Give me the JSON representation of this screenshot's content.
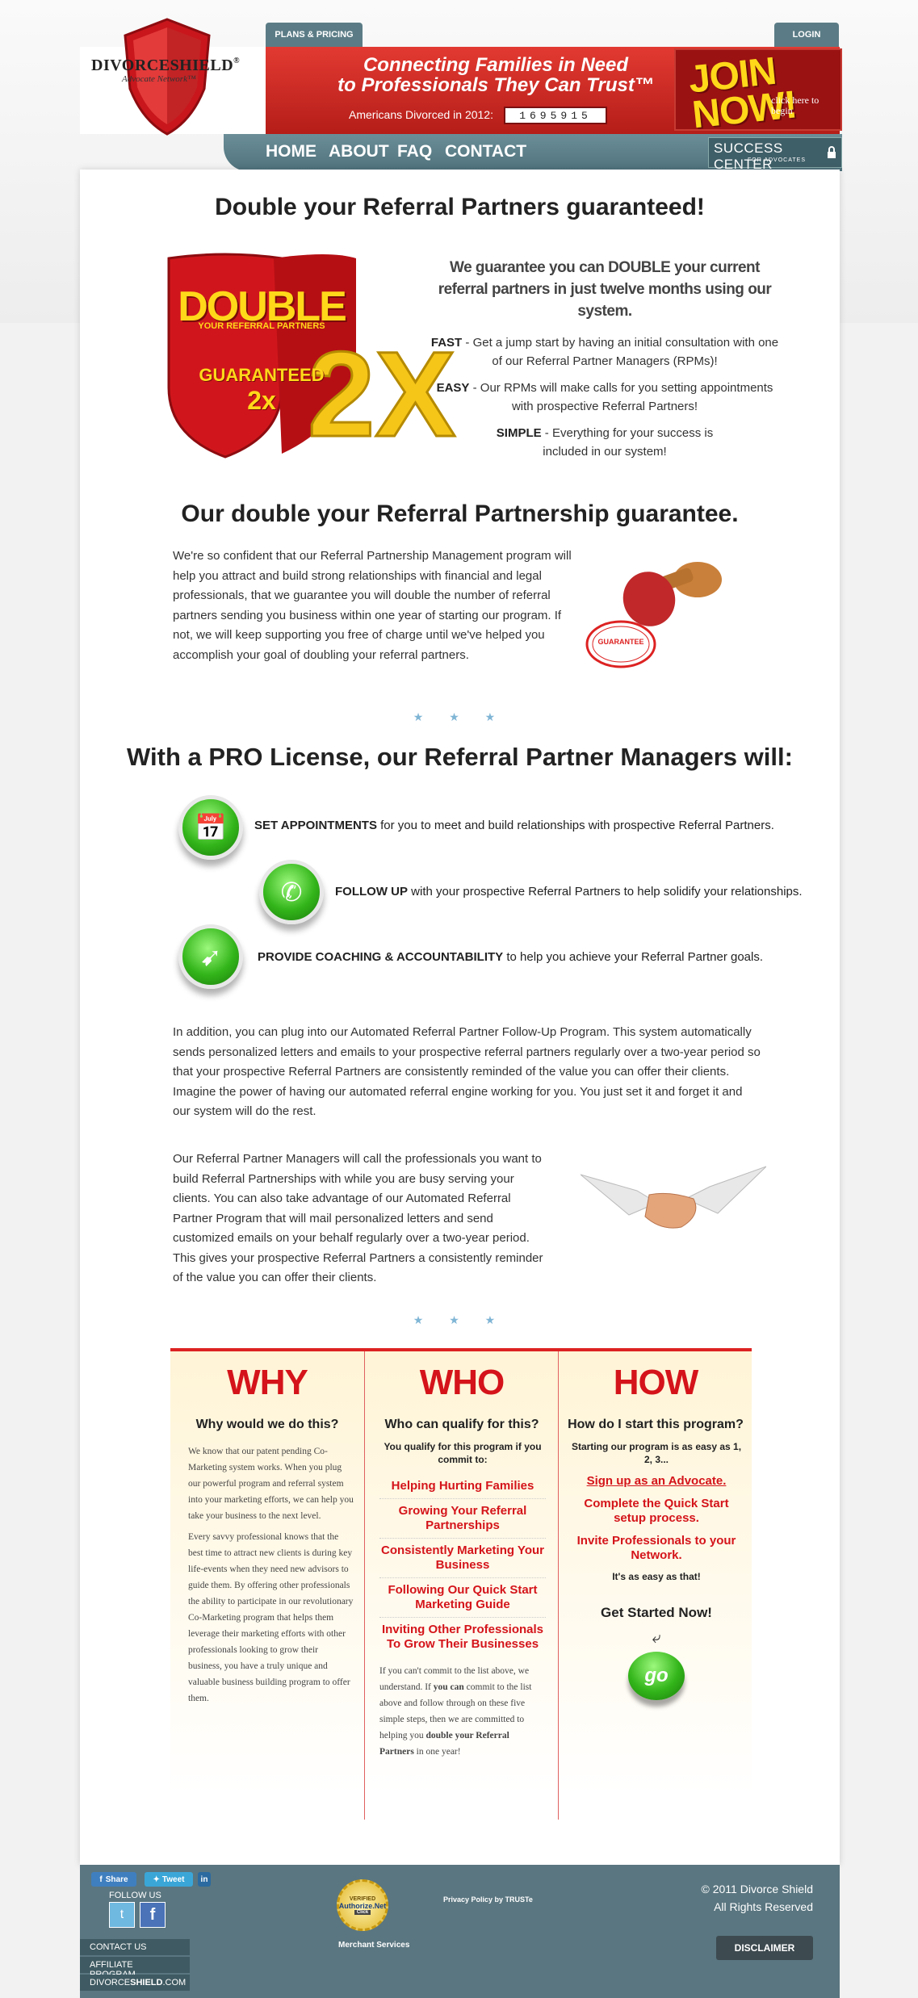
{
  "header": {
    "tab_plans": "PLANS & PRICING",
    "tab_login": "LOGIN",
    "logo_name_a": "DIVORCE",
    "logo_name_b": "SHIELD",
    "logo_reg": "®",
    "logo_sub": "Advocate Network™",
    "tagline_1": "Connecting Families in Need",
    "tagline_2": "to Professionals They Can Trust™",
    "counter_label": "Americans Divorced in 2012:",
    "counter_value": "1695915",
    "join_text": "JOIN NOW!",
    "join_small": "click here to begin",
    "nav": [
      "HOME",
      "ABOUT",
      "FAQ",
      "CONTACT"
    ],
    "success_title": "SUCCESS CENTER",
    "success_sub": "FOR ADVOCATES"
  },
  "hero": {
    "title": "Double your Referral Partners guaranteed!",
    "badge_double": "DOUBLE",
    "badge_sub": "YOUR REFERRAL PARTNERS",
    "badge_guar": "GUARANTEED",
    "badge_2x": "2x",
    "badge_big2x": "2X",
    "lead": "We guarantee you can DOUBLE your current referral partners in just twelve months using our system.",
    "fast_label": "FAST",
    "fast_text": "Get a jump start by having an initial consultation with one of our Referral Partner Managers (RPMs)!",
    "easy_label": "EASY",
    "easy_text": "Our RPMs will make calls for you setting appointments with prospective Referral Partners!",
    "simple_label": "SIMPLE",
    "simple_text": "Everything for your success is included in our system!"
  },
  "guarantee": {
    "title": "Our double your Referral Partnership guarantee.",
    "body": "We're so confident that our Referral Partnership Management program will help you attract and build strong relationships with financial and legal professionals, that we guarantee you will double the number of referral partners sending you business within one year of starting our program. If not, we will keep supporting you free of charge until we've helped you accomplish your goal of doubling your referral partners.",
    "stamp_text": "GUARANTEE"
  },
  "pro": {
    "title": "With a PRO License, our Referral Partner Managers will:",
    "f1_bold": "SET APPOINTMENTS",
    "f1_text": " for you to meet and build relationships with prospective Referral Partners.",
    "f2_bold": "FOLLOW UP",
    "f2_text": " with your prospective Referral Partners to help solidify your relationships.",
    "f3_bold": "PROVIDE COACHING & ACCOUNTABILITY",
    "f3_text": " to help you achieve your Referral Partner goals.",
    "para1": "In addition, you can plug into our Automated Referral Partner Follow-Up Program. This system automatically sends personalized letters and emails to your prospective referral partners regularly over a two-year period so that your prospective Referral Partners are consistently reminded of the value you can offer their clients. Imagine the power of having our automated referral engine working for you. You just set it and forget it and our system will do the rest.",
    "para2": "Our Referral Partner Managers will call the professionals you want to build Referral Partnerships with while you are busy serving your clients. You can also take advantage of our Automated Referral Partner Program that will mail personalized letters and send customized emails on your behalf regularly over a two-year period. This gives your prospective Referral Partners a consistently reminder of the value you can offer their clients."
  },
  "stars": "★ ★ ★",
  "why": {
    "heading": "WHY",
    "question": "Why would we do this?",
    "p1": "We know that our patent pending Co-Marketing system works. When you plug our powerful program and referral system into your marketing efforts, we can help you take your business to the next level.",
    "p2": "Every savvy professional knows that the best time to attract new clients is during key life-events when they need new advisors to guide them. By offering other professionals the ability to participate in our revolutionary Co-Marketing program that helps them leverage their marketing efforts with other professionals looking to grow their business, you have a truly unique and valuable business building program to offer them."
  },
  "who": {
    "heading": "WHO",
    "question": "Who can qualify for this?",
    "intro": "You qualify for this program if you commit to:",
    "items": [
      "Helping Hurting Families",
      "Growing Your Referral Partnerships",
      "Consistently Marketing Your Business",
      "Following Our Quick Start Marketing Guide",
      "Inviting Other Professionals To Grow Their Businesses"
    ],
    "foot_a": "If you can't commit to the list above, we understand. If ",
    "foot_b": "you can",
    "foot_c": " commit to the list above and follow through on these five simple steps, then we are committed to helping you ",
    "foot_d": "double your Referral Partners",
    "foot_e": " in one year!"
  },
  "how": {
    "heading": "HOW",
    "question": "How do I start this program?",
    "intro": "Starting our program is as easy as 1, 2, 3...",
    "items": [
      "Sign up as an Advocate.",
      "Complete the Quick Start setup process.",
      "Invite Professionals to your Network."
    ],
    "easy": "It's as easy as that!",
    "get_started": "Get Started Now!",
    "go_label": "go"
  },
  "footer": {
    "share": "Share",
    "tweet": "Tweet",
    "follow": "FOLLOW US",
    "links": [
      "CONTACT US",
      "AFFILIATE PROGRAM"
    ],
    "site_a": "DIVORCE",
    "site_b": "SHIELD",
    "site_c": ".COM",
    "auth_top": "VERIFIED",
    "auth": "Authorize.Net",
    "auth_click": "Click",
    "merchant": "Merchant Services",
    "privacy": "Privacy Policy by TRUSTe",
    "copyright": "© 2011 Divorce Shield",
    "rights": "All Rights Reserved",
    "disclaimer": "DISCLAIMER"
  },
  "colors": {
    "brand_red": "#d4141a",
    "nav_teal": "#5b7c86",
    "accent_yellow": "#ffd81a",
    "go_green": "#33b51a"
  }
}
